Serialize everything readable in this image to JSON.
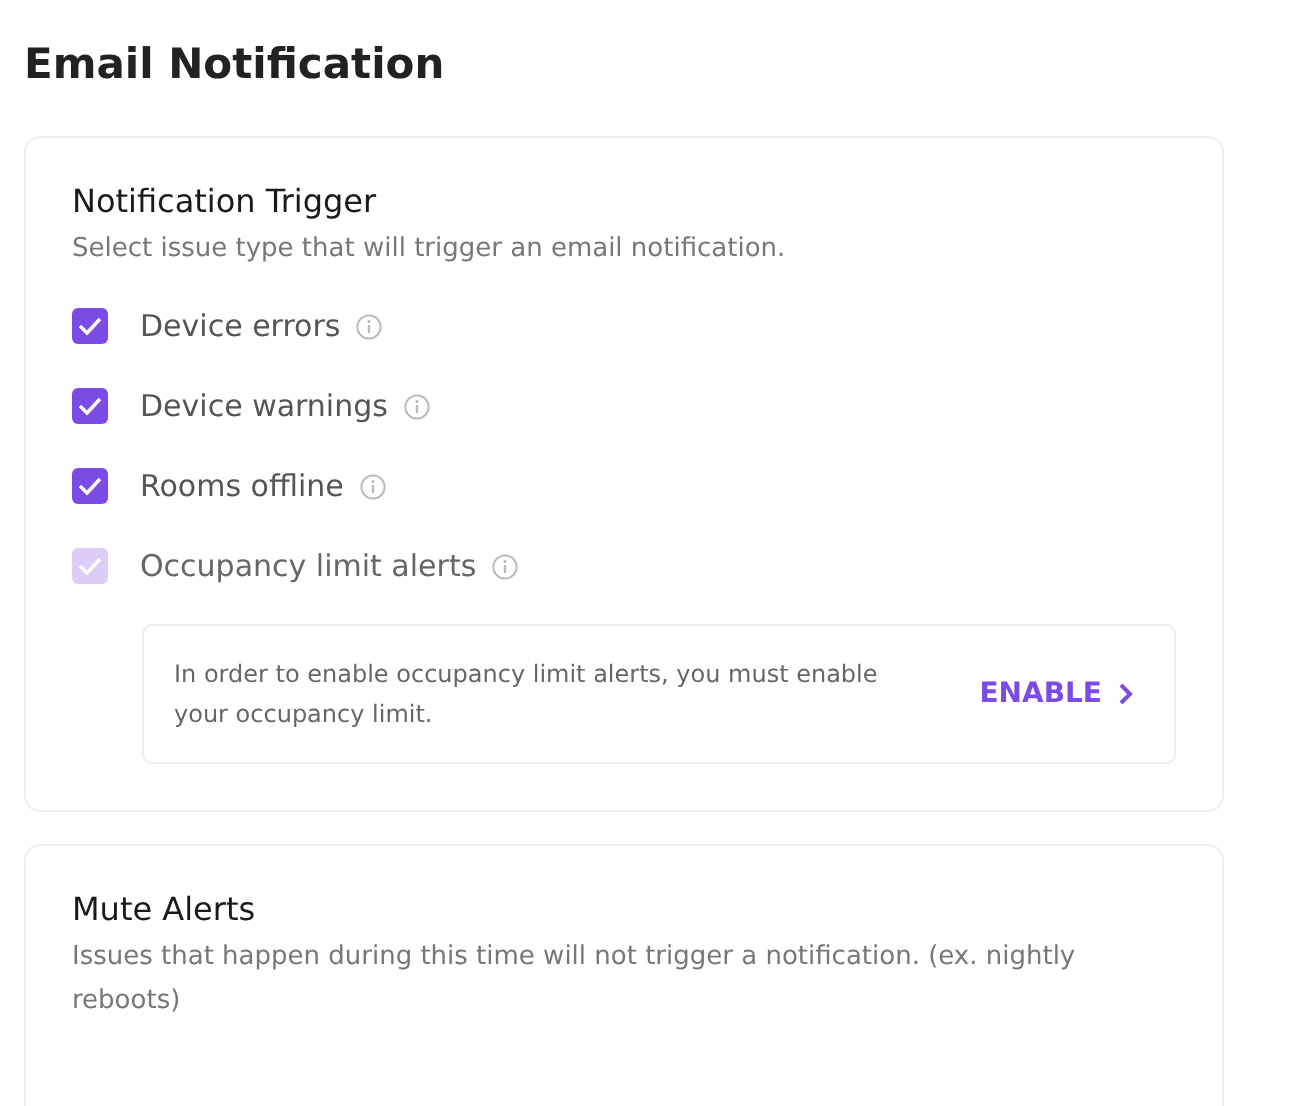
{
  "title": "Email Notification",
  "trigger": {
    "heading": "Notification Trigger",
    "description": "Select issue type that will trigger an email notification.",
    "items": [
      {
        "label": "Device errors",
        "checked": true,
        "disabled": false
      },
      {
        "label": "Device warnings",
        "checked": true,
        "disabled": false
      },
      {
        "label": "Rooms offline",
        "checked": true,
        "disabled": false
      },
      {
        "label": "Occupancy limit alerts",
        "checked": true,
        "disabled": true
      }
    ],
    "notice": {
      "text": "In order to enable occupancy limit alerts, you must enable your occupancy limit.",
      "action": "ENABLE"
    }
  },
  "mute": {
    "heading": "Mute Alerts",
    "description": "Issues that happen during this time will not trigger a notification. (ex. nightly reboots)"
  }
}
